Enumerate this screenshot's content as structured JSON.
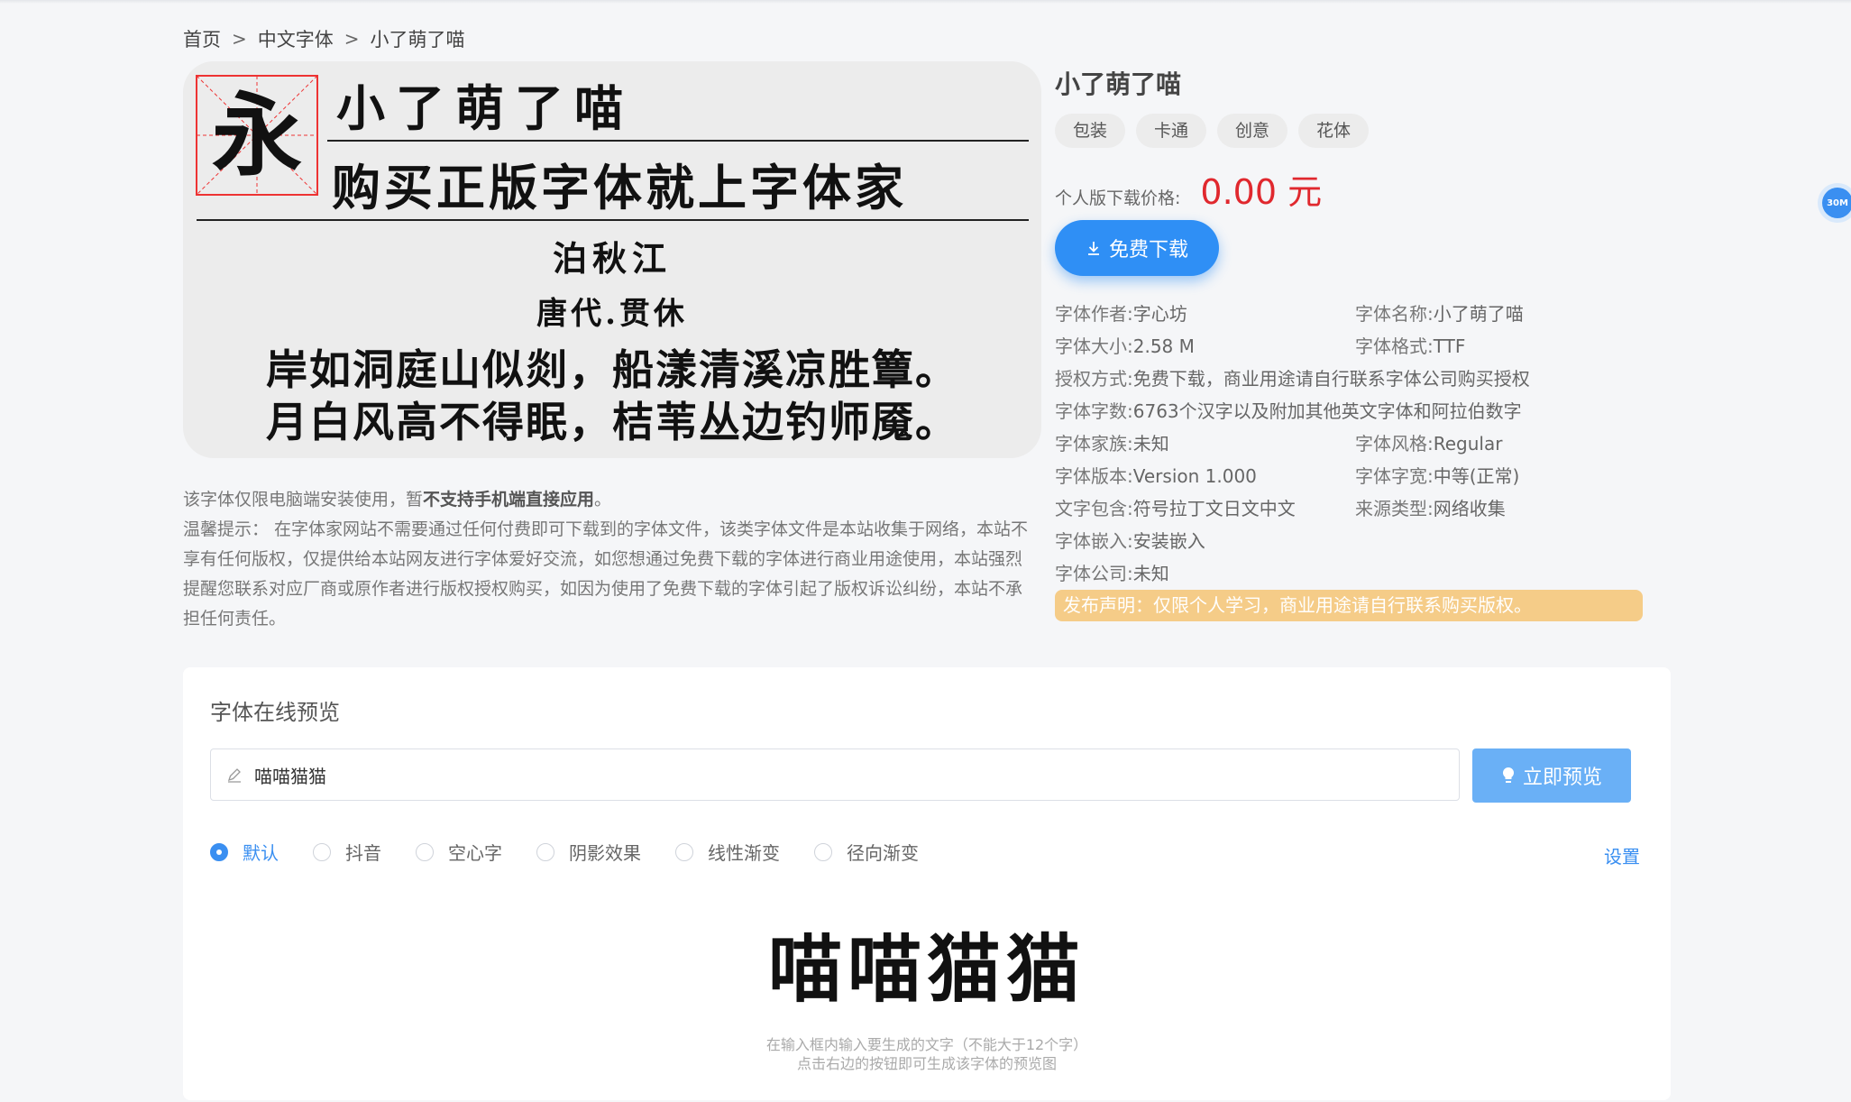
{
  "breadcrumb": {
    "home": "首页",
    "category": "中文字体",
    "current": "小了萌了喵",
    "sep": ">"
  },
  "hero": {
    "line1": "小了萌了喵",
    "line2": "购买正版字体就上字体家",
    "line3": "泊秋江",
    "line4": "唐代.贯休",
    "line5": "岸如洞庭山似剡，船漾清溪凉胜簟。",
    "line6": "月白风高不得眠，桔苇丛边钓师魇。",
    "glyph": "永"
  },
  "notice": {
    "p1_pre": "该字体仅限电脑端安装使用，暂",
    "p1_bold": "不支持手机端直接应用",
    "p1_post": "。",
    "p2": "温馨提示： 在字体家网站不需要通过任何付费即可下载到的字体文件，该类字体文件是本站收集于网络，本站不享有任何版权，仅提供给本站网友进行字体爱好交流，如您想通过免费下载的字体进行商业用途使用，本站强烈提醒您联系对应厂商或原作者进行版权授权购买，如因为使用了免费下载的字体引起了版权诉讼纠纷，本站不承担任何责任。"
  },
  "font": {
    "title": "小了萌了喵",
    "tags": [
      "包装",
      "卡通",
      "创意",
      "花体"
    ],
    "price_label": "个人版下载价格:",
    "price_value": "0.00 元",
    "download_label": "免费下载",
    "author_k": "字体作者:",
    "author_v": "字心坊",
    "name_k": "字体名称:",
    "name_v": "小了萌了喵",
    "size_k": "字体大小:",
    "size_v": "2.58 M",
    "format_k": "字体格式:",
    "format_v": "TTF",
    "license_k": "授权方式:",
    "license_v": "免费下载，商业用途请自行联系字体公司购买授权",
    "count_k": "字体字数:",
    "count_v": "6763个汉字以及附加其他英文字体和阿拉伯数字",
    "family_k": "字体家族:",
    "family_v": "未知",
    "style_k": "字体风格:",
    "style_v": "Regular",
    "version_k": "字体版本:",
    "version_v": "Version 1.000",
    "width_k": "字体字宽:",
    "width_v": "中等(正常)",
    "contains_k": "文字包含:",
    "contains_v": "符号拉丁文日文中文",
    "source_k": "来源类型:",
    "source_v": "网络收集",
    "embed_k": "字体嵌入:",
    "embed_v": "安装嵌入",
    "company_k": "字体公司:",
    "company_v": "未知",
    "declare": "发布声明：仅限个人学习，商业用途请自行联系购买版权。",
    "badge": "30M"
  },
  "preview": {
    "heading": "字体在线预览",
    "input_value": "喵喵猫猫",
    "button": "立即预览",
    "options": [
      "默认",
      "抖音",
      "空心字",
      "阴影效果",
      "线性渐变",
      "径向渐变"
    ],
    "selected": "默认",
    "settings": "设置",
    "sample": "喵喵猫猫",
    "hint1": "在输入框内输入要生成的文字（不能大于12个字）",
    "hint2": "点击右边的按钮即可生成该字体的预览图"
  },
  "colors": {
    "accent": "#2f8ff5",
    "price": "#e0282e",
    "declare_bg": "#f5cc88"
  },
  "icons": {
    "download": "download-icon",
    "pencil": "pencil-icon",
    "bulb": "bulb-icon",
    "chevron": "chevron-right-icon"
  }
}
